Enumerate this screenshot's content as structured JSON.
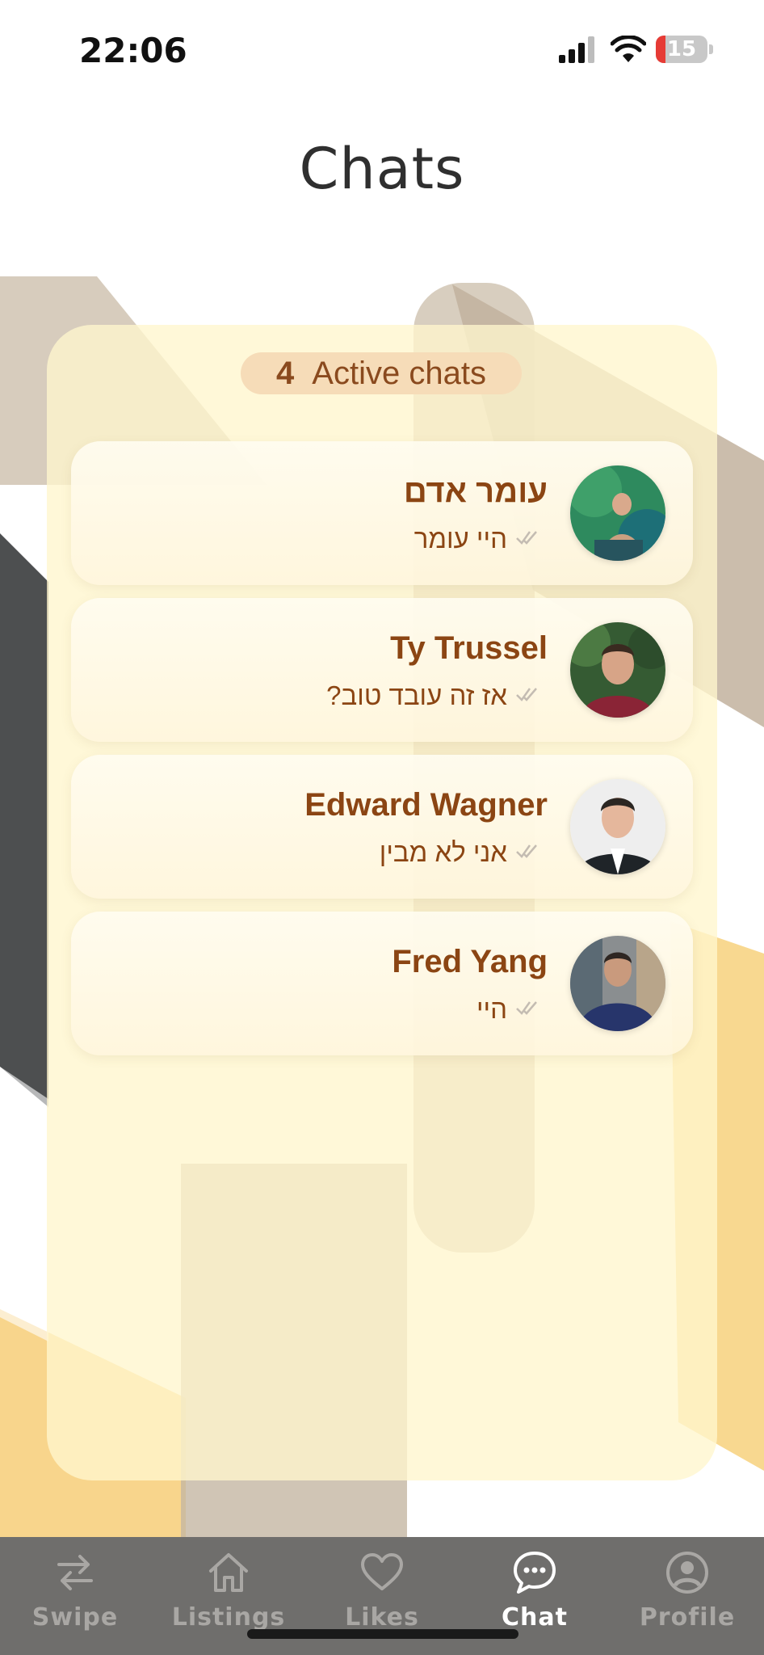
{
  "status_bar": {
    "time": "22:06",
    "battery_level": "15",
    "battery_color": "#e63b35"
  },
  "header": {
    "title": "Chats"
  },
  "summary": {
    "active_count": "4",
    "active_label": "Active chats"
  },
  "chats": [
    {
      "name": "עומר אדם",
      "last_message": "היי עומר",
      "status": "read",
      "avatar_icon": "user-photo"
    },
    {
      "name": "Ty Trussel",
      "last_message": "אז זה עובד טוב?",
      "status": "read",
      "avatar_icon": "user-photo"
    },
    {
      "name": "Edward Wagner",
      "last_message": "אני לא מבין",
      "status": "read",
      "avatar_icon": "user-photo"
    },
    {
      "name": "Fred Yang",
      "last_message": "היי",
      "status": "read",
      "avatar_icon": "user-photo"
    }
  ],
  "tab_bar": {
    "tabs": [
      {
        "label": "Swipe",
        "icon": "swap-arrows-icon",
        "active": false
      },
      {
        "label": "Listings",
        "icon": "home-icon",
        "active": false
      },
      {
        "label": "Likes",
        "icon": "heart-icon",
        "active": false
      },
      {
        "label": "Chat",
        "icon": "chat-bubble-icon",
        "active": true
      },
      {
        "label": "Profile",
        "icon": "user-circle-icon",
        "active": false
      }
    ]
  },
  "colors": {
    "accent_brown": "#8b4513",
    "panel_cream": "#fff6cd",
    "tab_bar_bg": "#6f6e6c"
  }
}
